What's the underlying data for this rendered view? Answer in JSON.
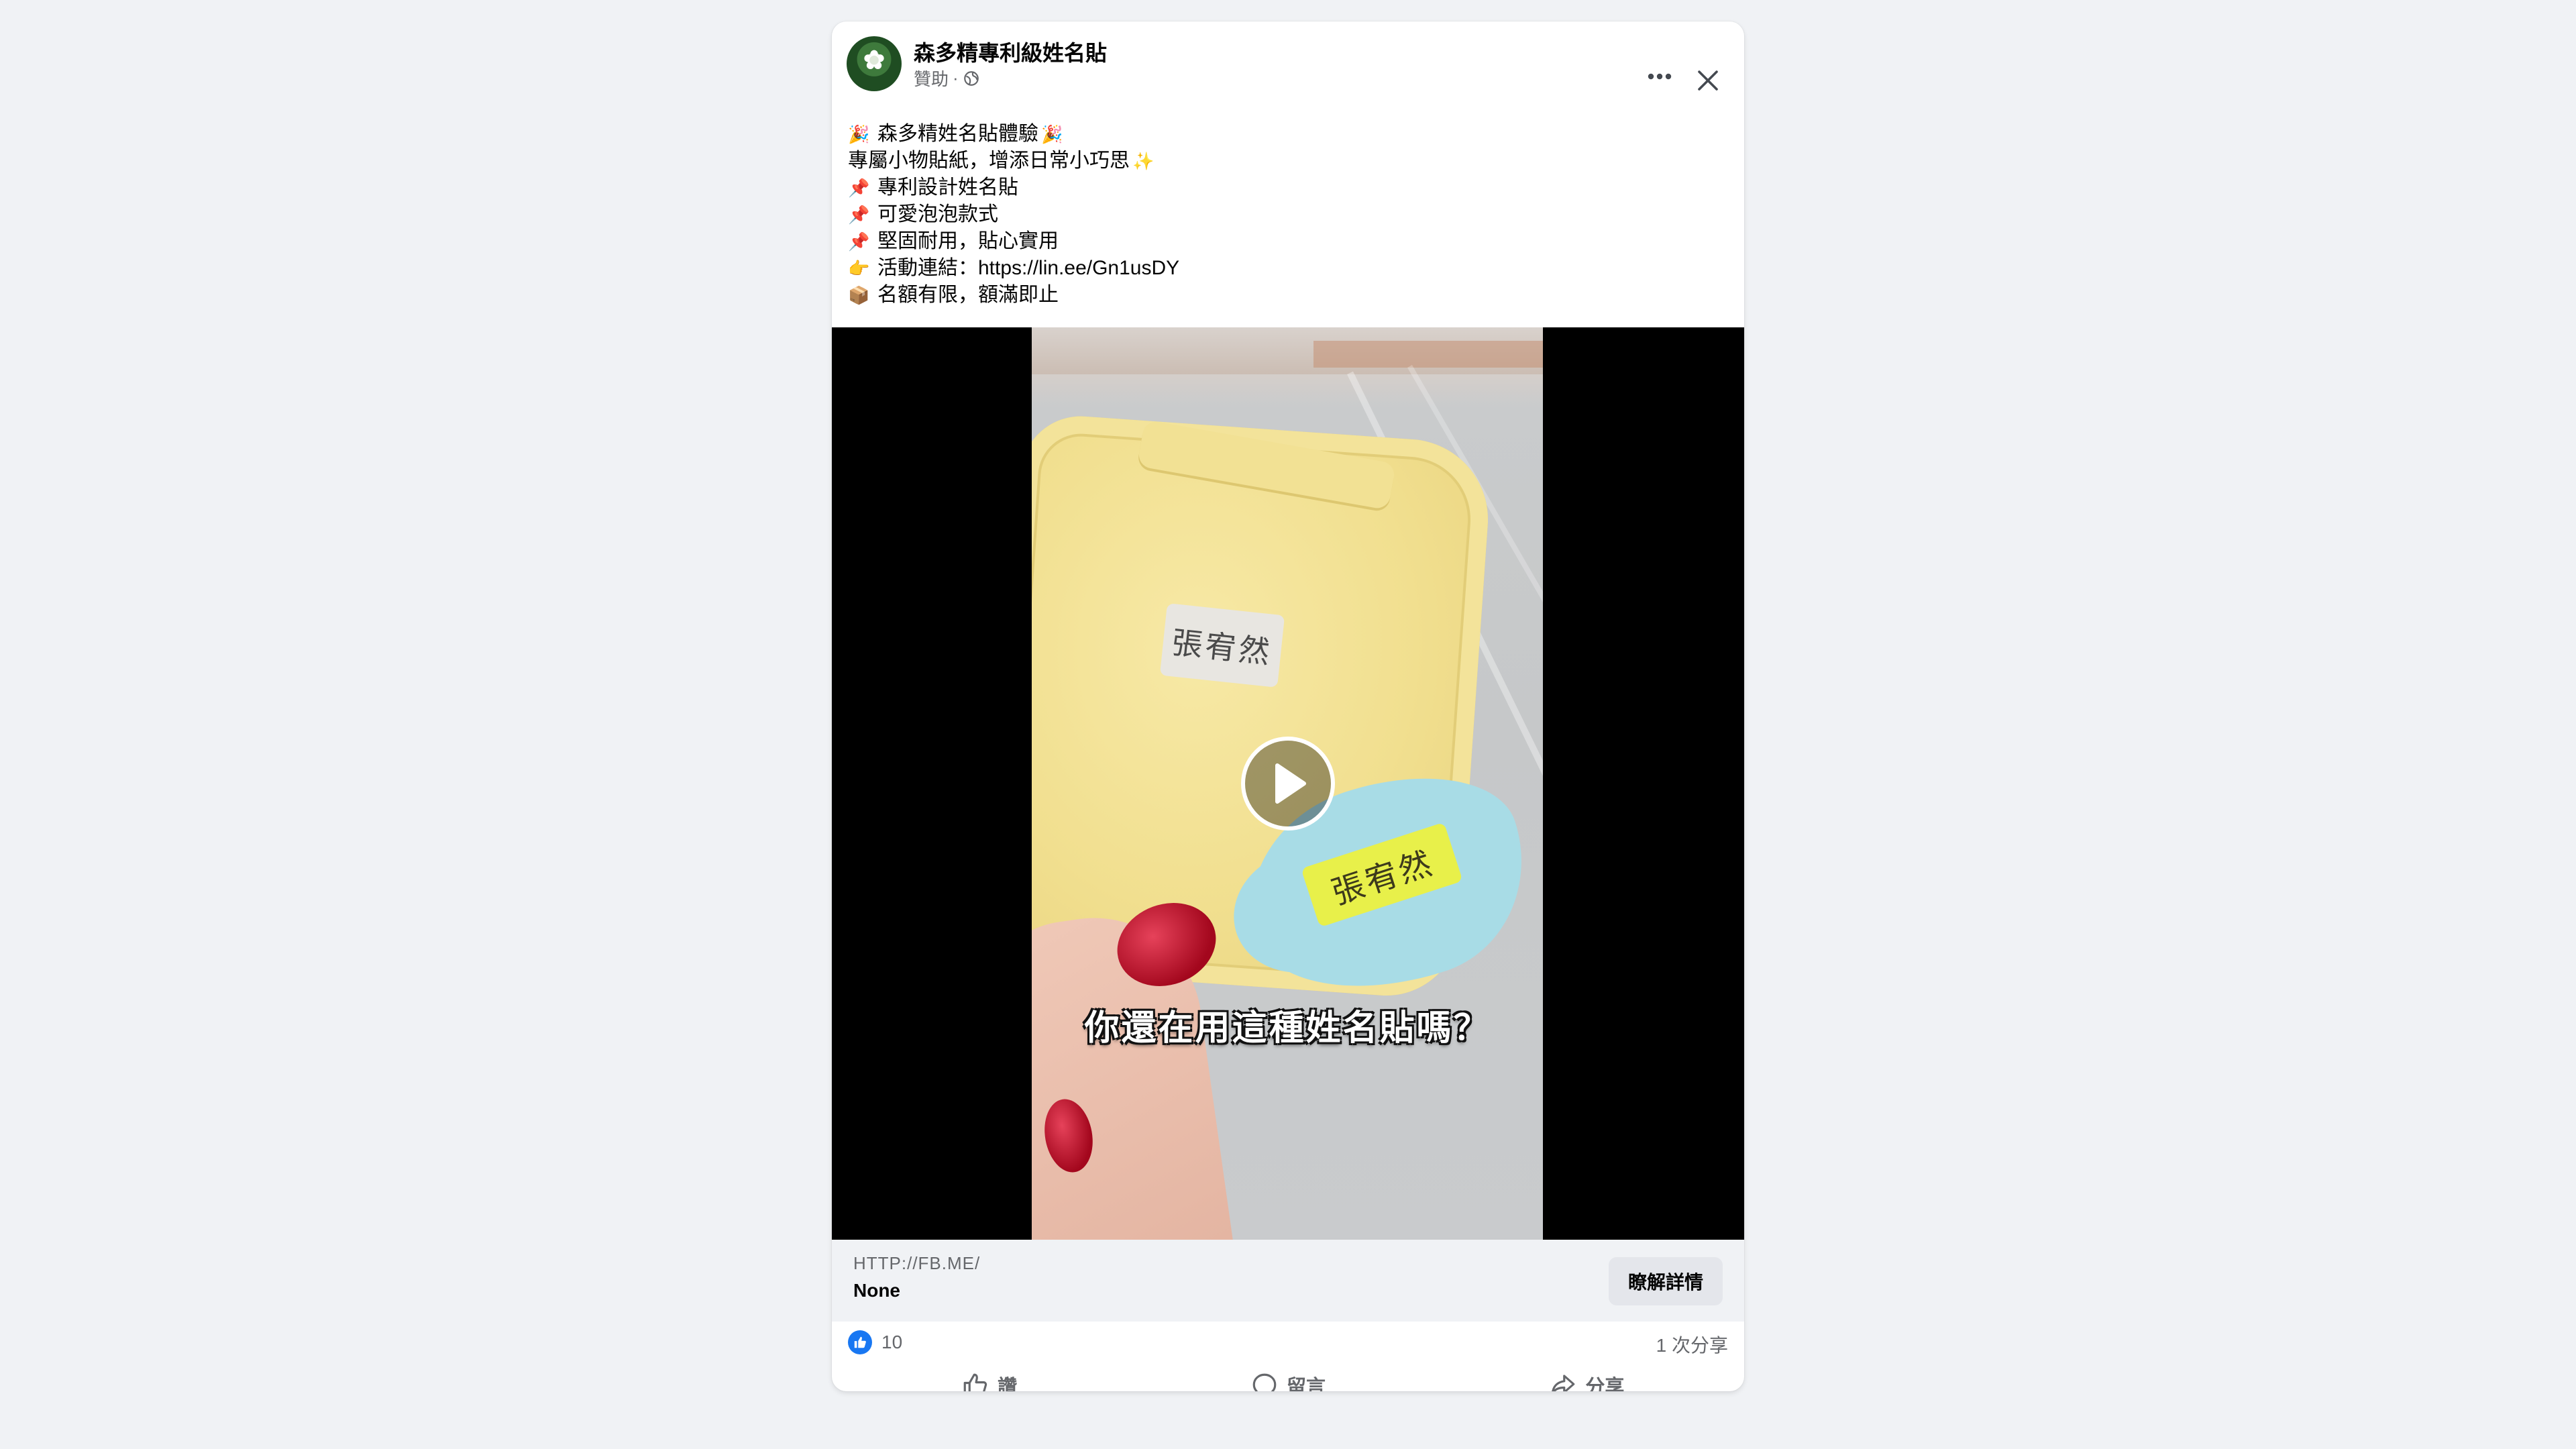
{
  "post": {
    "page_name": "森多精專利級姓名貼",
    "sponsored_label": "贊助",
    "separator": "·",
    "privacy_icon": "globe-icon",
    "more_icon": "more-horizontal-icon",
    "close_icon": "close-icon",
    "text_lines": [
      {
        "emoji": "🎉",
        "text": "森多精姓名貼體驗",
        "trailing_emoji": "🎉"
      },
      {
        "emoji": "",
        "text": "專屬小物貼紙，增添日常小巧思",
        "trailing_emoji": "✨"
      },
      {
        "emoji": "📌",
        "text": "專利設計姓名貼",
        "trailing_emoji": ""
      },
      {
        "emoji": "📌",
        "text": "可愛泡泡款式",
        "trailing_emoji": ""
      },
      {
        "emoji": "📌",
        "text": "堅固耐用，貼心實用",
        "trailing_emoji": ""
      },
      {
        "emoji": "👉",
        "text": "活動連結：https://lin.ee/Gn1usDY",
        "trailing_emoji": ""
      },
      {
        "emoji": "📦",
        "text": "名額有限，額滿即止",
        "trailing_emoji": ""
      }
    ]
  },
  "video": {
    "label_white": "張宥然",
    "label_yellow": "張宥然",
    "caption": "你還在用這種姓名貼嗎？",
    "play_icon": "play-icon"
  },
  "link_preview": {
    "domain": "HTTP://FB.ME/",
    "title": "None",
    "cta_label": "瞭解詳情"
  },
  "engagement": {
    "reaction_icon": "like-reaction-icon",
    "reaction_count": "10",
    "share_count": "1 次分享"
  },
  "actions": [
    {
      "label": "讚",
      "icon": "thumbs-up-icon"
    },
    {
      "label": "留言",
      "icon": "comment-icon"
    },
    {
      "label": "分享",
      "icon": "share-icon"
    }
  ],
  "colors": {
    "page_background": "#f0f2f5",
    "card_background": "#ffffff",
    "secondary_text": "#65676b",
    "like_blue": "#1877f2",
    "button_gray": "#e4e6eb"
  }
}
